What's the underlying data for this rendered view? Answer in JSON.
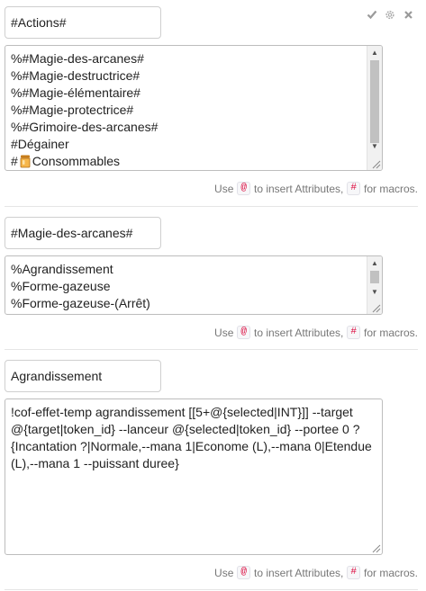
{
  "header": {
    "icons": [
      "checkmark-icon",
      "gear-icon",
      "close-icon"
    ]
  },
  "sections": [
    {
      "name": "#Actions#",
      "lines": [
        "%#Magie-des-arcanes#",
        "%#Magie-destructrice#",
        "%#Magie-élémentaire#",
        "%#Magie-protectrice#",
        "%#Grimoire-des-arcanes#",
        "#Dégainer"
      ],
      "last_line_prefix": "#",
      "last_line_text": "Consommables",
      "last_line_icon": "potion-jar-icon"
    },
    {
      "name": "#Magie-des-arcanes#",
      "lines": [
        "%Agrandissement",
        "%Forme-gazeuse",
        "%Forme-gazeuse-(Arrêt)"
      ]
    },
    {
      "name": "Agrandissement",
      "text": "!cof-effet-temp agrandissement [[5+@{selected|INT}]] --target @{target|token_id} --lanceur @{selected|token_id} --portee 0 ?{Incantation ?|Normale,--mana 1|Econome (L),--mana 0|Etendue (L),--mana 1 --puissant duree}"
    }
  ],
  "hint": {
    "use": "Use",
    "at": "@",
    "mid": "to insert Attributes,",
    "hash": "#",
    "end": "for macros."
  }
}
